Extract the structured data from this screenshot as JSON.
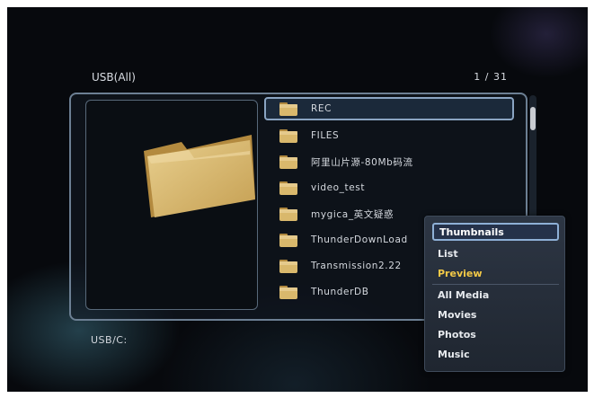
{
  "header": {
    "title": "USB(All)",
    "page_counter": "1 / 31"
  },
  "file_list": {
    "items": [
      {
        "label": "REC",
        "selected": true
      },
      {
        "label": "FILES",
        "selected": false
      },
      {
        "label": "阿里山片源-80Mb码流",
        "selected": false
      },
      {
        "label": "video_test",
        "selected": false
      },
      {
        "label": "mygica_英文疑惑",
        "selected": false
      },
      {
        "label": "ThunderDownLoad",
        "selected": false
      },
      {
        "label": "Transmission2.22",
        "selected": false
      },
      {
        "label": "ThunderDB",
        "selected": false
      }
    ]
  },
  "footer": {
    "path": "USB/C:"
  },
  "context_menu": {
    "view_modes": [
      {
        "label": "Thumbnails",
        "active": true
      },
      {
        "label": "List",
        "active": false
      },
      {
        "label": "Preview",
        "active": false
      }
    ],
    "filters": [
      {
        "label": "All Media"
      },
      {
        "label": "Movies"
      },
      {
        "label": "Photos"
      },
      {
        "label": "Music"
      }
    ]
  },
  "colors": {
    "background": "#07090d",
    "frame_border": "#6c7f93",
    "highlight_border": "#8eb0d6",
    "view_mode_text": "#f3c947",
    "folder_fill": "#d9b86c"
  },
  "icons": {
    "preview": "folder-icon",
    "list_item": "folder-icon"
  }
}
